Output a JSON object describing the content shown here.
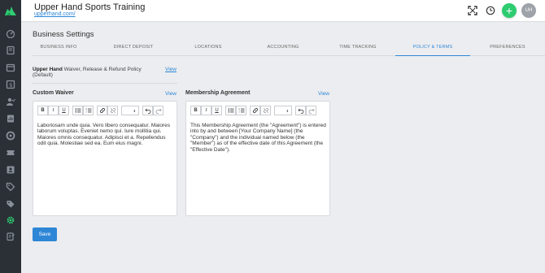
{
  "app": {
    "title": "Upper Hand Sports Training",
    "url": "upperhand.com/",
    "avatar_initials": "UH",
    "add_symbol": "+"
  },
  "sidebar": {
    "items": [
      {
        "icon": "dashboard-icon"
      },
      {
        "icon": "book-icon"
      },
      {
        "icon": "calendar-icon"
      },
      {
        "icon": "dollar-report-icon"
      },
      {
        "icon": "user-check-icon"
      },
      {
        "icon": "report-icon"
      },
      {
        "icon": "store-icon"
      },
      {
        "icon": "ticket-icon"
      },
      {
        "icon": "contacts-icon"
      },
      {
        "icon": "tag-icon"
      },
      {
        "icon": "tags-icon"
      },
      {
        "icon": "settings-gear-icon"
      },
      {
        "icon": "clipboard-icon"
      }
    ],
    "active_color": "#2ecc71"
  },
  "page": {
    "title": "Business Settings",
    "tabs": [
      {
        "label": "BUSINESS INFO"
      },
      {
        "label": "DIRECT DEPOSIT"
      },
      {
        "label": "LOCATIONS"
      },
      {
        "label": "ACCOUNTING"
      },
      {
        "label": "TIME TRACKING"
      },
      {
        "label": "POLICY & TERMS"
      },
      {
        "label": "PREFERENCES"
      }
    ],
    "active_tab": "POLICY & TERMS"
  },
  "policy": {
    "name": "Upper Hand",
    "description": "Waiver, Release & Refund Policy",
    "suffix": "(Default)",
    "view_label": "View"
  },
  "custom_waiver": {
    "label": "Custom Waiver",
    "view_label": "View",
    "text": "Laboriosam unde quia. Vero libero consequatur. Maiores laborum voluptas. Eveniet nemo qui. Iure mollitia qui. Maiores omnis consequatur. Adipisci et a. Repellendus odit quia. Molestiae sed ea. Eum eius magni."
  },
  "membership_agreement": {
    "label": "Membership Agreement",
    "view_label": "View",
    "text": "This Membership Agreement (the \"Agreement\") is entered into by and between [Your Company Name] (the \"Company\") and the individual named below (the \"Member\") as of the effective date of this Agreement (the \"Effective Date\")."
  },
  "toolbar": {
    "bold": "B",
    "italic": "I",
    "underline": "U",
    "select_arrow": "⬍"
  },
  "actions": {
    "save_label": "Save"
  },
  "colors": {
    "accent": "#2d86d6",
    "add": "#2ecc71",
    "sidebar_bg": "#2b3037"
  }
}
